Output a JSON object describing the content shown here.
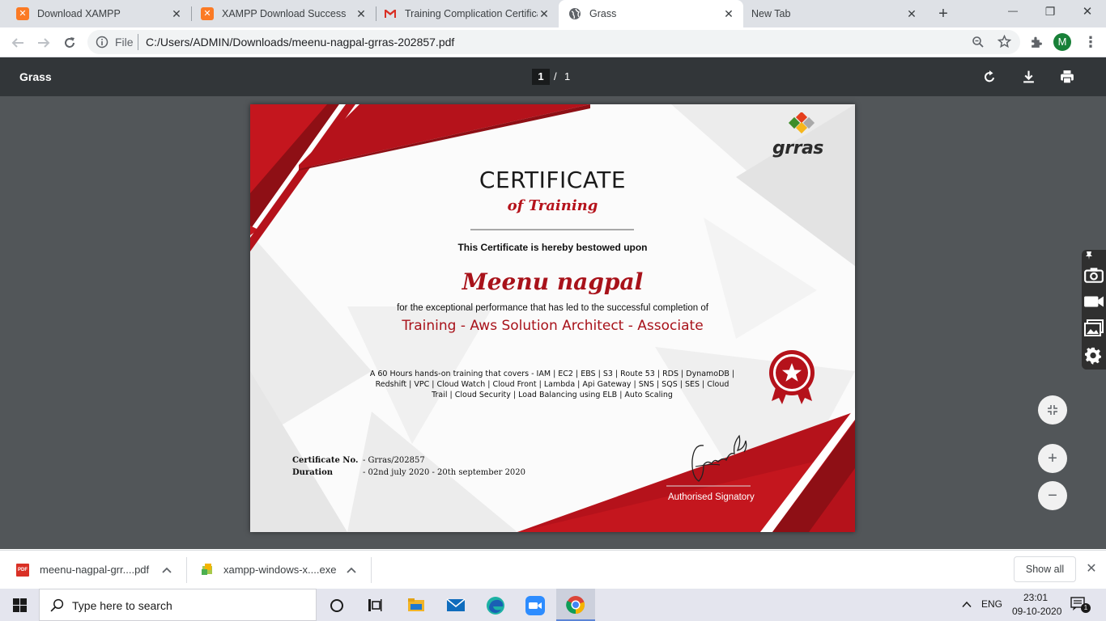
{
  "browser": {
    "tabs": [
      {
        "title": "Download XAMPP",
        "icon": "xampp-icon"
      },
      {
        "title": "XAMPP Download Success",
        "icon": "xampp-icon"
      },
      {
        "title": "Training Complication Certifica",
        "icon": "gmail-icon"
      },
      {
        "title": "Grass",
        "icon": "globe-icon"
      },
      {
        "title": "New Tab",
        "icon": "none"
      }
    ],
    "new_tab_glyph": "+",
    "window_controls": {
      "minimize": "—",
      "maximize": "❐",
      "close": "✕"
    },
    "address": {
      "scheme_label": "File",
      "url": "C:/Users/ADMIN/Downloads/meenu-nagpal-grras-202857.pdf"
    },
    "profile_initial": "M"
  },
  "pdf_viewer": {
    "title": "Grass",
    "current_page": "1",
    "page_separator": "/",
    "total_pages": "1"
  },
  "certificate": {
    "logo_text": "grras",
    "heading": "CERTIFICATE",
    "subheading": "of Training",
    "bestowed_text": "This Certificate is hereby bestowed upon",
    "recipient": "Meenu nagpal",
    "completion_text": "for the exceptional performance that has led to the successful completion of",
    "course": "Training - Aws Solution Architect - Associate",
    "description_lines": [
      "A 60 Hours hands-on training that covers - IAM | EC2 | EBS | S3 | Route 53 | RDS | DynamoDB |",
      "Redshift | VPC | Cloud Watch | Cloud Front | Lambda | Api Gateway | SNS | SQS | SES | Cloud",
      "Trail | Cloud Security | Load Balancing using ELB | Auto Scaling"
    ],
    "cert_no_label": "Certificate No.",
    "cert_no_value": "- Grras/202857",
    "duration_label": "Duration",
    "duration_value": "- 02nd july 2020 - 20th september 2020",
    "signatory": "Authorised Signatory",
    "colors": {
      "red": "#b5121b",
      "dark_red": "#8e0f15"
    }
  },
  "downloads": {
    "items": [
      {
        "name": "meenu-nagpal-grr....pdf",
        "icon": "pdf-icon"
      },
      {
        "name": "xampp-windows-x....exe",
        "icon": "xampp-installer-icon"
      }
    ],
    "show_all": "Show all"
  },
  "taskbar": {
    "search_placeholder": "Type here to search",
    "language": "ENG",
    "time": "23:01",
    "date": "09-10-2020",
    "notification_count": "1"
  }
}
